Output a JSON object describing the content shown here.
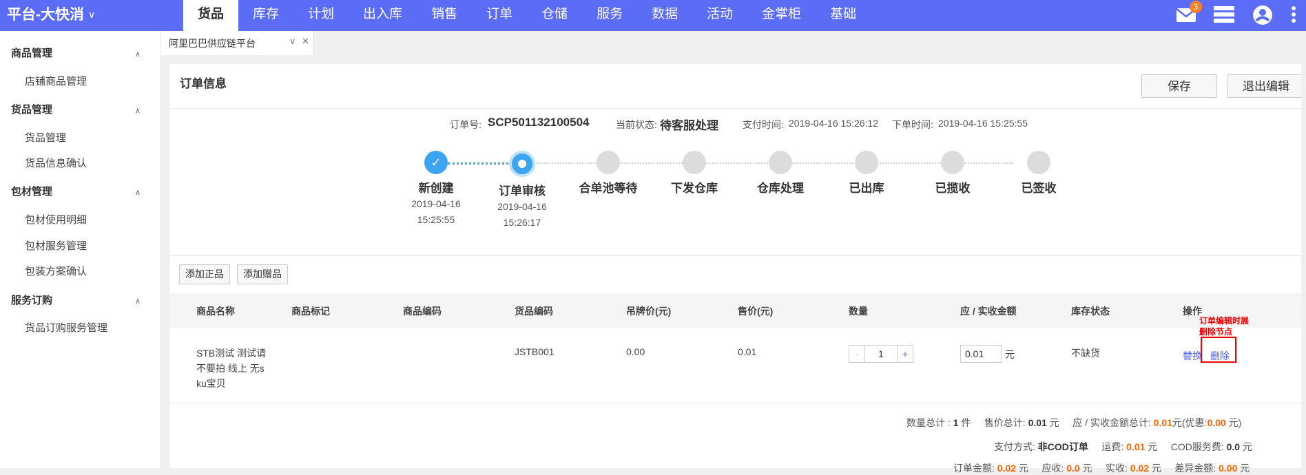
{
  "topbar": {
    "brand": "平台-大快消",
    "nav": [
      "货品",
      "库存",
      "计划",
      "出入库",
      "销售",
      "订单",
      "仓储",
      "服务",
      "数据",
      "活动",
      "金掌柜",
      "基础"
    ],
    "active_nav": "货品",
    "mail_badge": "3",
    "colors": {
      "bg": "#5b6cf7",
      "accent_badge": "#ff7f27"
    }
  },
  "sidebar": {
    "groups": [
      {
        "label": "商品管理",
        "items": [
          "店铺商品管理"
        ]
      },
      {
        "label": "货品管理",
        "items": [
          "货品管理",
          "货品信息确认"
        ]
      },
      {
        "label": "包材管理",
        "items": [
          "包材使用明细",
          "包材服务管理",
          "包装方案确认"
        ]
      },
      {
        "label": "服务订购",
        "items": [
          "货品订购服务管理"
        ]
      }
    ]
  },
  "tab": {
    "title": "阿里巴巴供应链平台"
  },
  "panel": {
    "title": "订单信息",
    "save_label": "保存",
    "exit_label": "退出编辑"
  },
  "order_info": {
    "order_no_label": "订单号:",
    "order_no": "SCP501132100504",
    "status_label": "当前状态:",
    "status": "待客服处理",
    "pay_time_label": "支付时间:",
    "pay_time": "2019-04-16 15:26:12",
    "order_time_label": "下单时间:",
    "order_time": "2019-04-16 15:25:55"
  },
  "steps": [
    {
      "label": "新创建",
      "date": "2019-04-16",
      "time": "15:25:55",
      "state": "done"
    },
    {
      "label": "订单审核",
      "date": "2019-04-16",
      "time": "15:26:17",
      "state": "current"
    },
    {
      "label": "合单池等待",
      "state": "pending"
    },
    {
      "label": "下发仓库",
      "state": "pending"
    },
    {
      "label": "仓库处理",
      "state": "pending"
    },
    {
      "label": "已出库",
      "state": "pending"
    },
    {
      "label": "已揽收",
      "state": "pending"
    },
    {
      "label": "已签收",
      "state": "pending"
    }
  ],
  "actions": {
    "add_normal": "添加正品",
    "add_gift": "添加赠品"
  },
  "table": {
    "headers": [
      "商品名称",
      "商品标记",
      "商品编码",
      "货品编码",
      "吊牌价(元)",
      "售价(元)",
      "数量",
      "应 / 实收金额",
      "库存状态",
      "操作"
    ],
    "row": {
      "name_lines": [
        "STB测试 测试请",
        "不要拍 线上 无s",
        "ku宝贝"
      ],
      "goods_code": "JSTB001",
      "tag_price": "0.00",
      "price": "0.01",
      "qty_minus": "-",
      "qty": "1",
      "qty_plus": "+",
      "amount": "0.01",
      "amount_unit": "元",
      "stock_status": "不缺货",
      "op_replace": "替换",
      "op_delete": "删除"
    }
  },
  "annotation": {
    "line1": "订单编辑时展",
    "line2": "删除节点",
    "color": "#e00000"
  },
  "summary": {
    "qty_label": "数量总计 :",
    "qty": "1",
    "qty_unit": "件",
    "sale_label": "售价总计:",
    "sale": "0.01",
    "sale_unit": "元",
    "amount_label": "应 / 实收金额总计:",
    "amount": "0.01",
    "amount_unit": "元(优惠:",
    "discount": "0.00",
    "discount_unit": "元)",
    "pay_label": "支付方式:",
    "pay": "非COD订单",
    "freight_label": "运费:",
    "freight": "0.01",
    "freight_unit": "元",
    "cod_label": "COD服务费:",
    "cod": "0.0",
    "cod_unit": "元",
    "order_amt_label": "订单金额:",
    "order_amt": "0.02",
    "order_amt_unit": "元",
    "receivable_label": "应收:",
    "receivable": "0.0",
    "receivable_unit": "元",
    "received_label": "实收:",
    "received": "0.02",
    "received_unit": "元",
    "diff_label": "差异金额:",
    "diff": "0.00",
    "diff_unit": "元"
  }
}
